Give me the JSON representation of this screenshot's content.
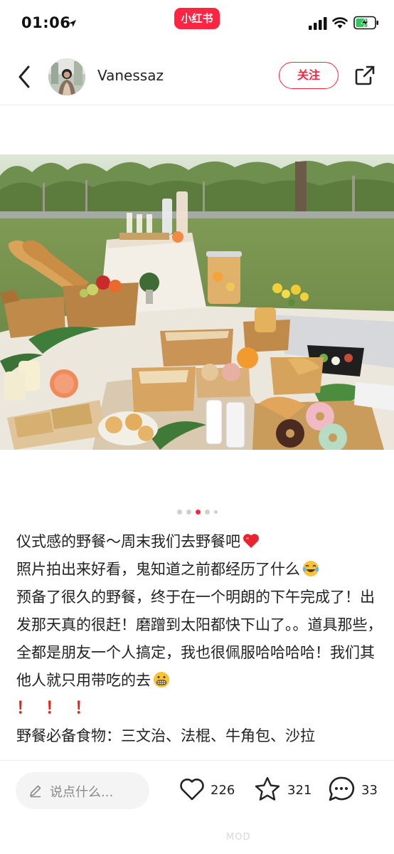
{
  "status": {
    "time": "01:06",
    "app_badge": "小红书"
  },
  "header": {
    "username": "Vanessaz",
    "follow_label": "关注"
  },
  "carousel": {
    "count": 5,
    "active_index": 2
  },
  "post": {
    "lines": [
      "仪式感的野餐～周末我们去野餐吧",
      "照片拍出来好看，鬼知道之前都经历了什么",
      "预备了很久的野餐，终于在一个明朗的下午完成了！出发那天真的很赶！磨蹭到太阳都快下山了。。道具那些，全都是朋友一个人搞定，我也很佩服哈哈哈哈！我们其他人就只用带吃的去",
      "！！！",
      "野餐必备食物：三文治、法棍、牛角包、沙拉"
    ],
    "exclaim": "！"
  },
  "bottom": {
    "comment_placeholder": "说点什么...",
    "likes": "226",
    "collects": "321",
    "comments": "33",
    "watermark": "MOD"
  },
  "colors": {
    "brand": "#ff2442",
    "heart_emoji": "#e8242f",
    "exclaim": "#e2241a"
  },
  "icons": {
    "location": "location-arrow-icon",
    "signal": "signal-bars-icon",
    "wifi": "wifi-icon",
    "battery": "battery-charging-icon",
    "back": "back-chevron-icon",
    "share": "share-icon",
    "pencil": "pencil-icon",
    "like": "heart-icon",
    "collect": "star-icon",
    "comment": "comment-bubble-icon"
  }
}
